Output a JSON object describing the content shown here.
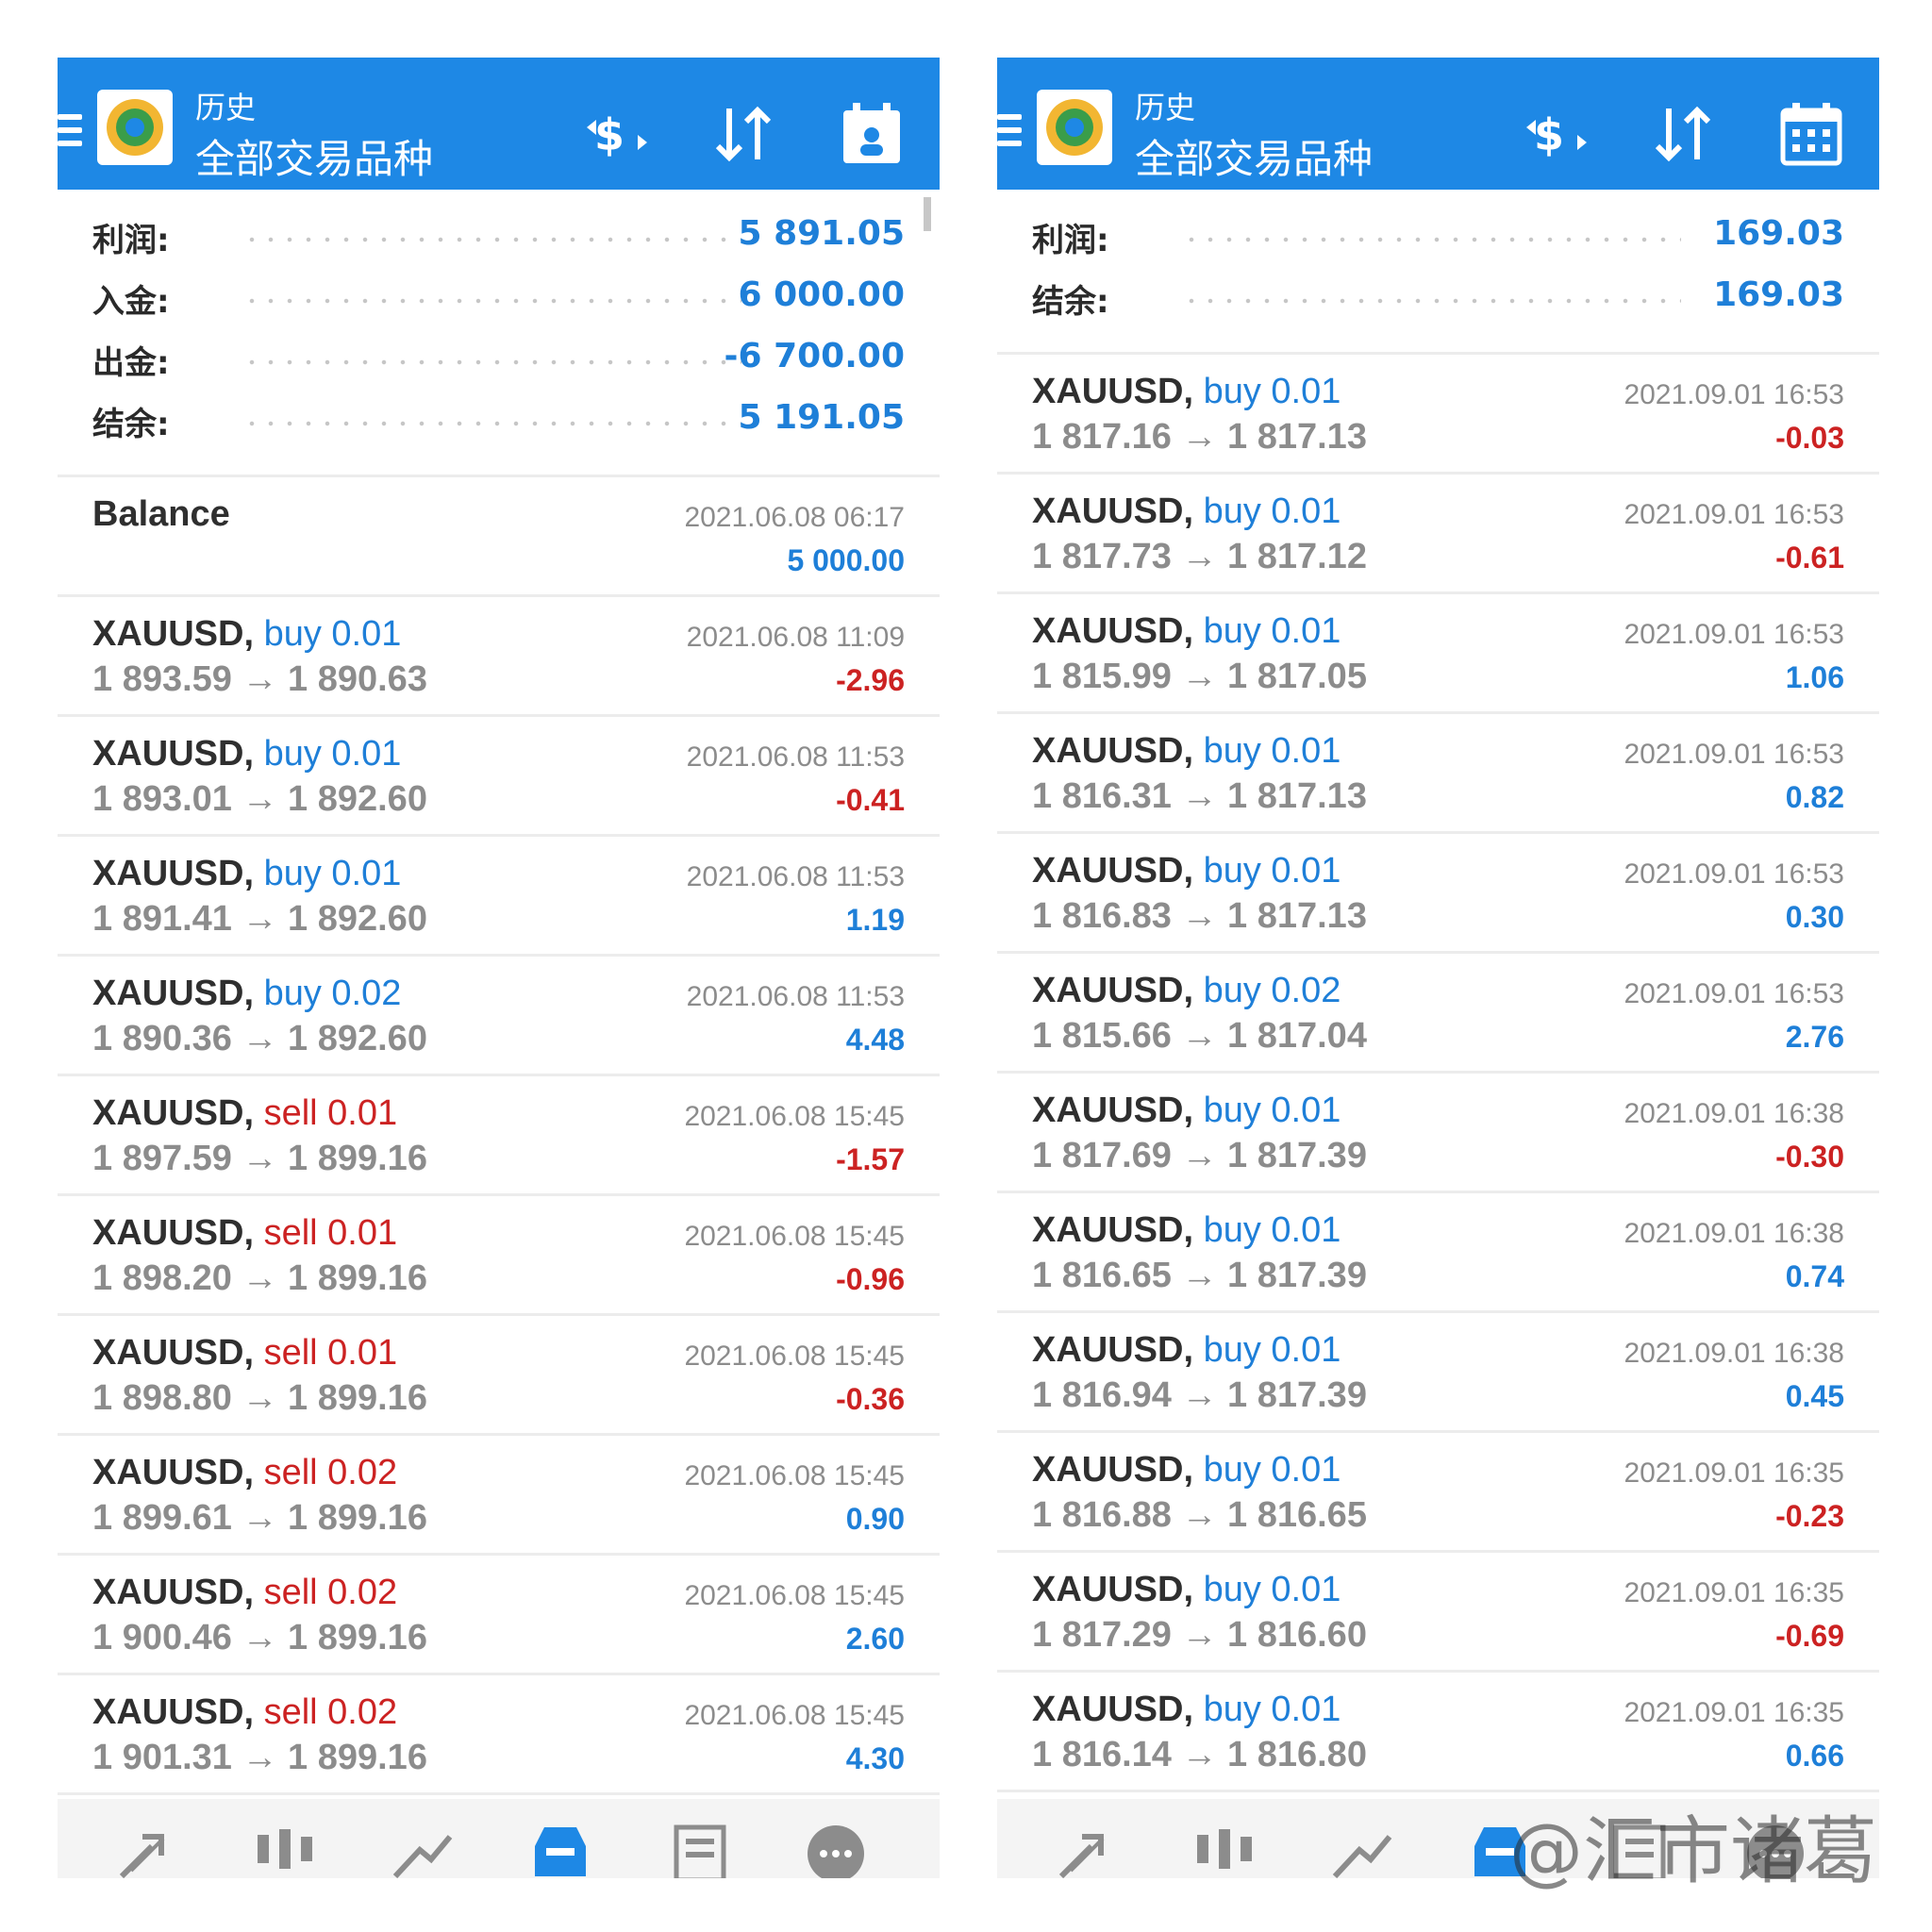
{
  "colors": {
    "header": "#1e88e5",
    "blue": "#1e7fd8",
    "red": "#cc2222",
    "gray": "#8c8c8c"
  },
  "watermark": "@汇市诸葛",
  "left": {
    "header": {
      "title_small": "历史",
      "title_big": "全部交易品种"
    },
    "summary": [
      {
        "label": "利润:",
        "value": "5 891.05"
      },
      {
        "label": "入金:",
        "value": "6 000.00"
      },
      {
        "label": "出金:",
        "value": "-6 700.00"
      },
      {
        "label": "结余:",
        "value": "5 191.05"
      }
    ],
    "balance": {
      "label": "Balance",
      "date": "2021.06.08 06:17",
      "value": "5 000.00"
    },
    "trades": [
      {
        "symbol": "XAUUSD,",
        "dir": "buy 0.01",
        "prices": "1 893.59 → 1 890.63",
        "date": "2021.06.08 11:09",
        "profit": "-2.96"
      },
      {
        "symbol": "XAUUSD,",
        "dir": "buy 0.01",
        "prices": "1 893.01 → 1 892.60",
        "date": "2021.06.08 11:53",
        "profit": "-0.41"
      },
      {
        "symbol": "XAUUSD,",
        "dir": "buy 0.01",
        "prices": "1 891.41 → 1 892.60",
        "date": "2021.06.08 11:53",
        "profit": "1.19"
      },
      {
        "symbol": "XAUUSD,",
        "dir": "buy 0.02",
        "prices": "1 890.36 → 1 892.60",
        "date": "2021.06.08 11:53",
        "profit": "4.48"
      },
      {
        "symbol": "XAUUSD,",
        "dir": "sell 0.01",
        "prices": "1 897.59 → 1 899.16",
        "date": "2021.06.08 15:45",
        "profit": "-1.57"
      },
      {
        "symbol": "XAUUSD,",
        "dir": "sell 0.01",
        "prices": "1 898.20 → 1 899.16",
        "date": "2021.06.08 15:45",
        "profit": "-0.96"
      },
      {
        "symbol": "XAUUSD,",
        "dir": "sell 0.01",
        "prices": "1 898.80 → 1 899.16",
        "date": "2021.06.08 15:45",
        "profit": "-0.36"
      },
      {
        "symbol": "XAUUSD,",
        "dir": "sell 0.02",
        "prices": "1 899.61 → 1 899.16",
        "date": "2021.06.08 15:45",
        "profit": "0.90"
      },
      {
        "symbol": "XAUUSD,",
        "dir": "sell 0.02",
        "prices": "1 900.46 → 1 899.16",
        "date": "2021.06.08 15:45",
        "profit": "2.60"
      },
      {
        "symbol": "XAUUSD,",
        "dir": "sell 0.02",
        "prices": "1 901.31 → 1 899.16",
        "date": "2021.06.08 15:45",
        "profit": "4.30"
      }
    ]
  },
  "right": {
    "header": {
      "title_small": "历史",
      "title_big": "全部交易品种"
    },
    "summary": [
      {
        "label": "利润:",
        "value": "169.03"
      },
      {
        "label": "结余:",
        "value": "169.03"
      }
    ],
    "trades": [
      {
        "symbol": "XAUUSD,",
        "dir": "buy 0.01",
        "prices": "1 817.16 → 1 817.13",
        "date": "2021.09.01 16:53",
        "profit": "-0.03"
      },
      {
        "symbol": "XAUUSD,",
        "dir": "buy 0.01",
        "prices": "1 817.73 → 1 817.12",
        "date": "2021.09.01 16:53",
        "profit": "-0.61"
      },
      {
        "symbol": "XAUUSD,",
        "dir": "buy 0.01",
        "prices": "1 815.99 → 1 817.05",
        "date": "2021.09.01 16:53",
        "profit": "1.06"
      },
      {
        "symbol": "XAUUSD,",
        "dir": "buy 0.01",
        "prices": "1 816.31 → 1 817.13",
        "date": "2021.09.01 16:53",
        "profit": "0.82"
      },
      {
        "symbol": "XAUUSD,",
        "dir": "buy 0.01",
        "prices": "1 816.83 → 1 817.13",
        "date": "2021.09.01 16:53",
        "profit": "0.30"
      },
      {
        "symbol": "XAUUSD,",
        "dir": "buy 0.02",
        "prices": "1 815.66 → 1 817.04",
        "date": "2021.09.01 16:53",
        "profit": "2.76"
      },
      {
        "symbol": "XAUUSD,",
        "dir": "buy 0.01",
        "prices": "1 817.69 → 1 817.39",
        "date": "2021.09.01 16:38",
        "profit": "-0.30"
      },
      {
        "symbol": "XAUUSD,",
        "dir": "buy 0.01",
        "prices": "1 816.65 → 1 817.39",
        "date": "2021.09.01 16:38",
        "profit": "0.74"
      },
      {
        "symbol": "XAUUSD,",
        "dir": "buy 0.01",
        "prices": "1 816.94 → 1 817.39",
        "date": "2021.09.01 16:38",
        "profit": "0.45"
      },
      {
        "symbol": "XAUUSD,",
        "dir": "buy 0.01",
        "prices": "1 816.88 → 1 816.65",
        "date": "2021.09.01 16:35",
        "profit": "-0.23"
      },
      {
        "symbol": "XAUUSD,",
        "dir": "buy 0.01",
        "prices": "1 817.29 → 1 816.60",
        "date": "2021.09.01 16:35",
        "profit": "-0.69"
      },
      {
        "symbol": "XAUUSD,",
        "dir": "buy 0.01",
        "prices": "1 816.14 → 1 816.80",
        "date": "2021.09.01 16:35",
        "profit": "0.66"
      }
    ]
  },
  "icons": {
    "header": [
      "menu-icon",
      "app-logo-icon",
      "deals-money-icon",
      "sort-icon",
      "calendar-icon"
    ],
    "bottom_nav": [
      "quotes-icon",
      "chart-icon",
      "trade-icon",
      "history-icon",
      "news-icon",
      "chat-icon"
    ]
  }
}
